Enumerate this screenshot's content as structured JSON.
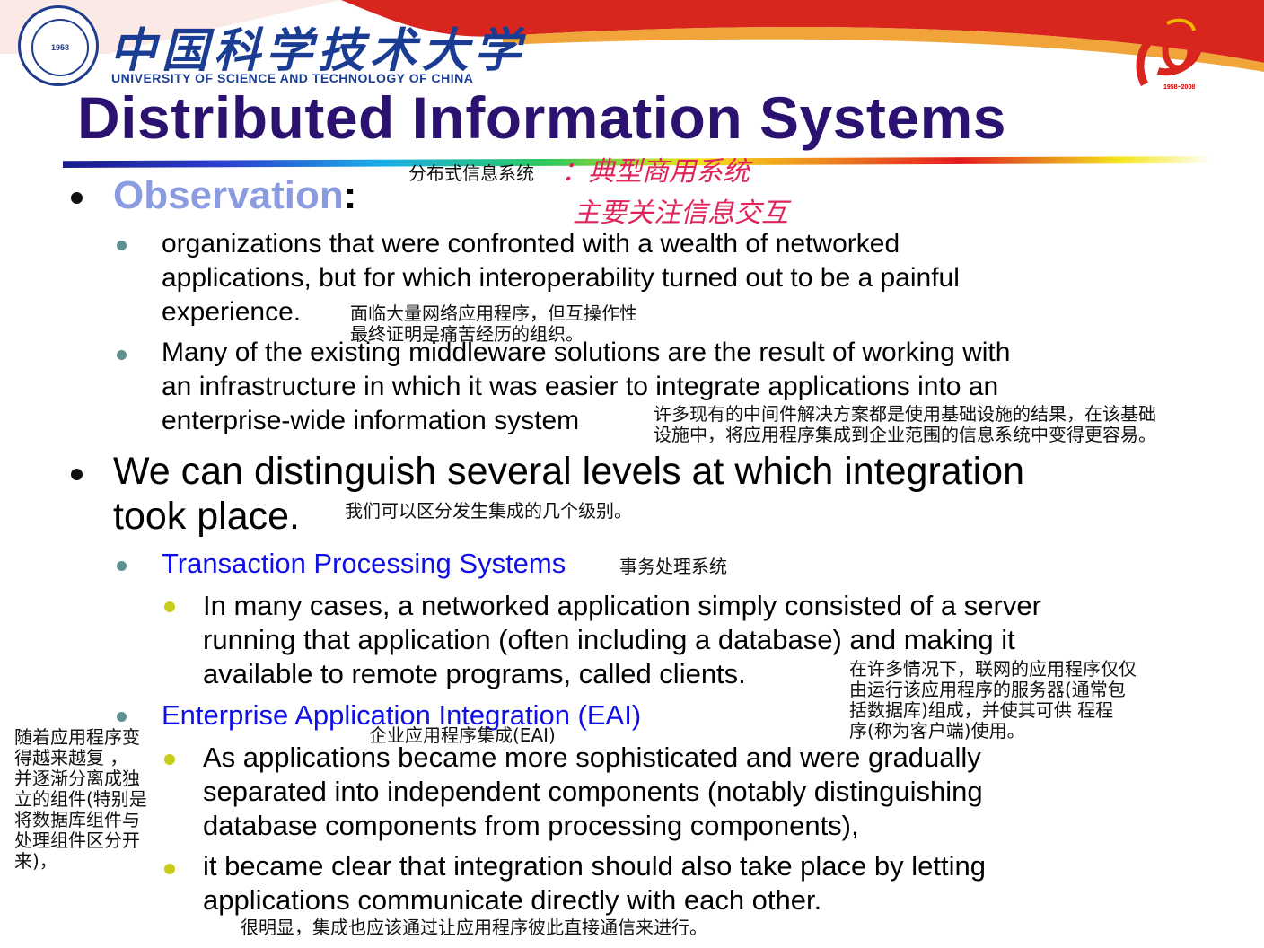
{
  "header": {
    "university_cn": "中国科学技术大学",
    "university_en": "UNIVERSITY OF SCIENCE AND TECHNOLOGY OF CHINA",
    "seal_year": "1958",
    "anniversary_years": "1958~2008"
  },
  "title": "Distributed Information Systems",
  "annotations": {
    "title_cn": "分布式信息系统",
    "handwritten_1": "：典型商用系统",
    "handwritten_2": "主要关注信息交互"
  },
  "observation": {
    "label": "Observation",
    "colon": ":",
    "items": [
      {
        "lines": [
          "organizations that were confronted with a wealth of networked",
          "applications, but for which interoperability turned out to be a painful",
          "experience."
        ],
        "note": [
          "面临大量网络应用程序，但互操作性",
          "最终证明是痛苦经历的组织。"
        ]
      },
      {
        "lines": [
          "Many of the existing middleware solutions are the result of working with",
          "an infrastructure in which it was easier to integrate applications into an",
          "enterprise-wide information system"
        ],
        "note": [
          "许多现有的中间件解决方案都是使用基础设施的结果，在该基础",
          "设施中，将应用程序集成到企业范围的信息系统中变得更容易。"
        ]
      }
    ]
  },
  "levels": {
    "lines": [
      "We can distinguish several levels at which integration",
      "took place."
    ],
    "note": "我们可以区分发生集成的几个级别。",
    "tps": {
      "label": "Transaction Processing Systems",
      "note": "事务处理系统",
      "lines": [
        "In many cases, a networked application simply consisted of a server",
        "running that application (often including a database) and making it",
        "available to remote programs, called clients."
      ],
      "detail_note": [
        "在许多情况下，联网的应用程序仅仅",
        "由运行该应用程序的服务器(通常包",
        "括数据库)组成，并使其可供   程程",
        "序(称为客户端)使用。"
      ]
    },
    "eai": {
      "label": "Enterprise Application Integration (EAI)",
      "note": "企业应用程序集成(EAI)",
      "item1_lines": [
        "As applications became more sophisticated and were gradually",
        "separated into independent components (notably distinguishing",
        "database components from processing components),"
      ],
      "item1_note": [
        "随着应用程序变",
        "得越来越复    ，",
        "并逐渐分离成独",
        "立的组件(特别是",
        "将数据库组件与",
        "处理组件区分开",
        "来)，"
      ],
      "item2_lines": [
        "it became clear that integration should also take place by letting",
        "applications communicate directly with each other."
      ],
      "item2_note": "很明显，集成也应该通过让应用程序彼此直接通信来进行。"
    }
  },
  "colors": {
    "title": "#2b1270",
    "observation": "#8b9be0",
    "link_blue": "#1010e6",
    "handwriting": "#e0245a",
    "header_red": "#d8261f"
  }
}
